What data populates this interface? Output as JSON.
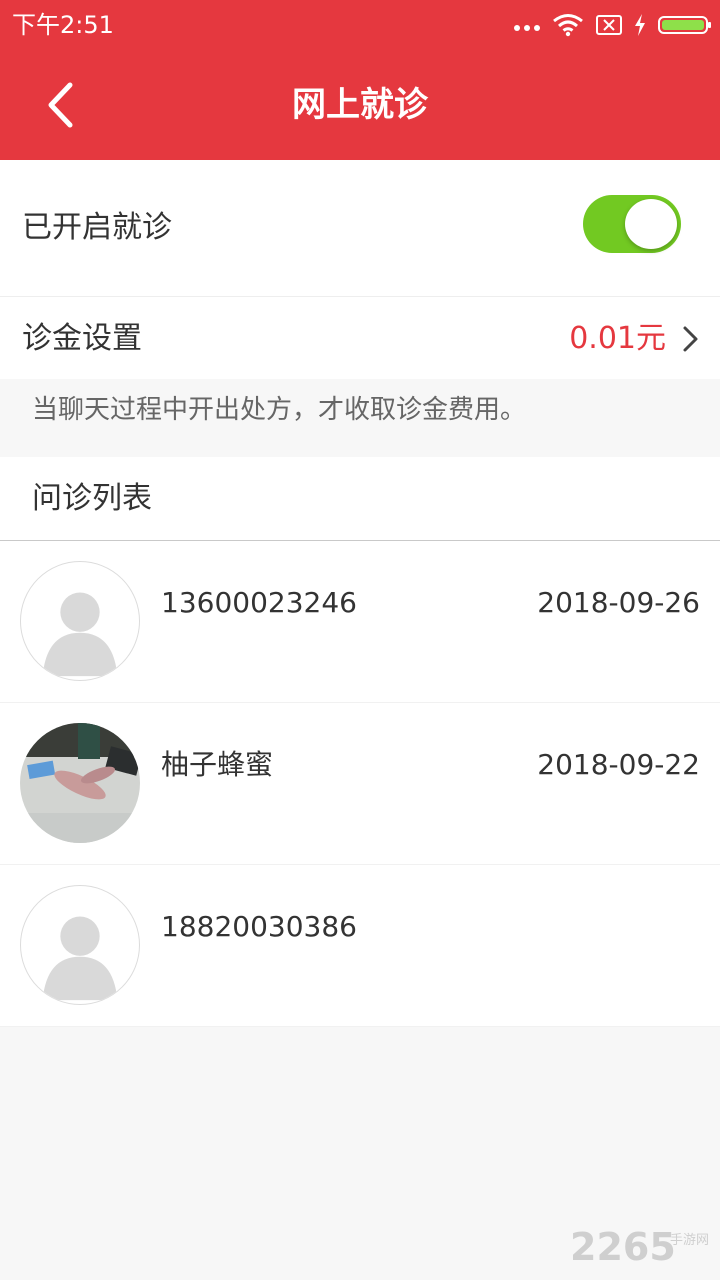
{
  "status_bar": {
    "time": "下午2:51"
  },
  "nav": {
    "title": "网上就诊"
  },
  "consult": {
    "label": "已开启就诊",
    "enabled": true
  },
  "fee": {
    "label": "诊金设置",
    "value": "0.01元",
    "hint": "当聊天过程中开出处方，才收取诊金费用。"
  },
  "list": {
    "header": "问诊列表",
    "items": [
      {
        "name": "13600023246",
        "date": "2018-09-26",
        "avatar": "default-avatar-icon"
      },
      {
        "name": "柚子蜂蜜",
        "date": "2018-09-22",
        "avatar": "photo-avatar"
      },
      {
        "name": "18820030386",
        "date": "",
        "avatar": "default-avatar-icon"
      }
    ]
  },
  "watermark": {
    "text": "2265",
    "sub": "手游网"
  },
  "colors": {
    "brand": "#e5383f",
    "toggle_on": "#72c922",
    "price": "#e5383f"
  }
}
